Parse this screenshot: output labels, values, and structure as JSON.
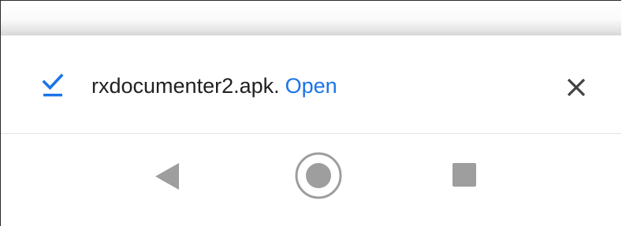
{
  "download_notice": {
    "icon": "download-complete-check-icon",
    "filename": "rxdocumenter2.apk.",
    "action_label": "Open",
    "dismiss_icon": "close-icon",
    "colors": {
      "accent": "#1a73e8",
      "text": "#212121",
      "icon_gray": "#424242"
    }
  },
  "navigation_bar": {
    "back_icon": "back-triangle-icon",
    "home_icon": "home-circle-icon",
    "recents_icon": "recents-square-icon",
    "icon_color": "#9e9e9e"
  }
}
